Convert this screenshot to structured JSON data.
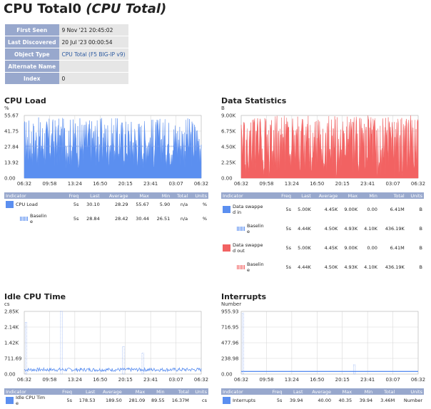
{
  "page": {
    "title": "CPU Total0",
    "subtitle": "(CPU Total)"
  },
  "info": [
    {
      "key": "First Seen",
      "value": "9 Nov '21 20:45:02",
      "link": false
    },
    {
      "key": "Last Discovered",
      "value": "20 Jul '23 00:00:54",
      "link": false
    },
    {
      "key": "Object Type",
      "value": "CPU Total (F5 BIG-IP v9)",
      "link": true
    },
    {
      "key": "Alternate Name",
      "value": "",
      "link": false
    },
    {
      "key": "Index",
      "value": "0",
      "link": false
    }
  ],
  "x_ticks": [
    "06:32",
    "09:58",
    "13:24",
    "16:50",
    "20:15",
    "23:41",
    "03:07",
    "06:32"
  ],
  "colors": {
    "blue": "#5b8ff0",
    "red": "#f26262",
    "baseline_blue": "#7b9ff0",
    "baseline_red": "#f08a8a",
    "header": "#98a8cd",
    "grid": "#d8d8d8"
  },
  "panels": {
    "cpu_load": {
      "title": "CPU Load",
      "unit": "%",
      "columns": [
        "Indicator",
        "Freq",
        "Last",
        "Average",
        "Max",
        "Min",
        "Total",
        "Units"
      ],
      "rows": [
        {
          "indicator": "CPU Load",
          "swatch": "solid-blue",
          "freq": "5s",
          "last": "30.10",
          "average": "28.29",
          "max": "55.67",
          "min": "5.90",
          "total": "n/a",
          "units": "%"
        },
        {
          "indicator": "Baseline",
          "swatch": "dot-blue",
          "freq": "5s",
          "last": "28.84",
          "average": "28.42",
          "max": "30.44",
          "min": "26.51",
          "total": "n/a",
          "units": "%"
        }
      ]
    },
    "data_statistics": {
      "title": "Data Statistics",
      "unit": "B",
      "columns": [
        "Indicator",
        "Freq",
        "Last",
        "Average",
        "Max",
        "Min",
        "Total",
        "Units"
      ],
      "rows": [
        {
          "indicator": "Data swapped in",
          "swatch": "solid-blue",
          "freq": "5s",
          "last": "5.00K",
          "average": "4.45K",
          "max": "9.00K",
          "min": "0.00",
          "total": "6.41M",
          "units": "B"
        },
        {
          "indicator": "Baseline",
          "swatch": "dot-blue",
          "freq": "5s",
          "last": "4.44K",
          "average": "4.50K",
          "max": "4.93K",
          "min": "4.10K",
          "total": "436.19K",
          "units": "B"
        },
        {
          "indicator": "Data swapped out",
          "swatch": "solid-red",
          "freq": "5s",
          "last": "5.00K",
          "average": "4.45K",
          "max": "9.00K",
          "min": "0.00",
          "total": "6.41M",
          "units": "B"
        },
        {
          "indicator": "Baseline",
          "swatch": "dot-red",
          "freq": "5s",
          "last": "4.44K",
          "average": "4.50K",
          "max": "4.93K",
          "min": "4.10K",
          "total": "436.19K",
          "units": "B"
        }
      ]
    },
    "idle_cpu": {
      "title": "Idle CPU Time",
      "unit": "cs",
      "columns": [
        "Indicator",
        "Freq",
        "Last",
        "Average",
        "Max",
        "Min",
        "Total",
        "Units"
      ],
      "rows": [
        {
          "indicator": "Idle CPU Time",
          "swatch": "solid-blue",
          "freq": "5s",
          "last": "178.53",
          "average": "189.50",
          "max": "281.09",
          "min": "89.55",
          "total": "16.37M",
          "units": "cs"
        }
      ]
    },
    "interrupts": {
      "title": "Interrupts",
      "unit": "Number",
      "columns": [
        "Indicator",
        "Freq",
        "Last",
        "Average",
        "Max",
        "Min",
        "Total",
        "Units"
      ],
      "rows": [
        {
          "indicator": "Interrupts",
          "swatch": "solid-blue",
          "freq": "5s",
          "last": "39.94",
          "average": "40.00",
          "max": "40.35",
          "min": "39.94",
          "total": "3.46M",
          "units": "Number"
        }
      ]
    }
  },
  "chart_data": [
    {
      "type": "area",
      "title": "CPU Load",
      "ylabel": "%",
      "ylim": [
        0,
        55.67
      ],
      "yticks": [
        "0.00",
        "13.92",
        "27.84",
        "41.75",
        "55.67"
      ],
      "xticks": [
        "06:32",
        "09:58",
        "13:24",
        "16:50",
        "20:15",
        "23:41",
        "03:07",
        "06:32"
      ],
      "series": [
        {
          "name": "CPU Load",
          "last": 30.1,
          "average": 28.29,
          "max": 55.67,
          "min": 5.9
        },
        {
          "name": "Baseline",
          "average": 28.42
        }
      ]
    },
    {
      "type": "area",
      "title": "Data Statistics",
      "ylabel": "B",
      "ylim": [
        0,
        9000
      ],
      "yticks": [
        "0.00",
        "2.25K",
        "4.50K",
        "6.75K",
        "9.00K"
      ],
      "xticks": [
        "06:32",
        "09:58",
        "13:24",
        "16:50",
        "20:15",
        "23:41",
        "03:07",
        "06:32"
      ],
      "series": [
        {
          "name": "Data swapped in",
          "average": 4450,
          "max": 9000,
          "min": 0
        },
        {
          "name": "Data swapped out",
          "average": 4450,
          "max": 9000,
          "min": 0
        },
        {
          "name": "Baseline",
          "average": 4500
        }
      ]
    },
    {
      "type": "line",
      "title": "Idle CPU Time",
      "ylabel": "cs",
      "ylim": [
        0,
        2850
      ],
      "yticks": [
        "0.00",
        "711.69",
        "1.42K",
        "2.14K",
        "2.85K"
      ],
      "xticks": [
        "06:32",
        "09:58",
        "13:24",
        "16:50",
        "20:15",
        "23:41",
        "03:07",
        "06:32"
      ],
      "series": [
        {
          "name": "Idle CPU Time",
          "average": 189.5,
          "max": 281.09,
          "min": 89.55
        },
        {
          "name": "Baseline spikes",
          "x": [
            0.01,
            0.21,
            0.56,
            0.67
          ],
          "values": [
            2350,
            2850,
            1250,
            950
          ]
        }
      ]
    },
    {
      "type": "line",
      "title": "Interrupts",
      "ylabel": "Number",
      "ylim": [
        0,
        955.93
      ],
      "yticks": [
        "0.00",
        "238.98",
        "477.96",
        "716.95",
        "955.93"
      ],
      "xticks": [
        "06:32",
        "09:58",
        "13:24",
        "16:50",
        "20:15",
        "23:41",
        "03:07",
        "06:32"
      ],
      "series": [
        {
          "name": "Interrupts",
          "average": 40.0,
          "max": 40.35,
          "min": 39.94
        },
        {
          "name": "Baseline spikes",
          "x": [
            0.01,
            0.64
          ],
          "values": [
            930,
            140
          ]
        }
      ]
    }
  ]
}
